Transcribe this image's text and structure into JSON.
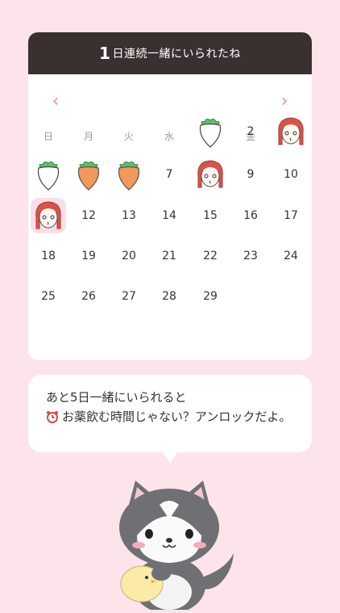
{
  "header": {
    "streak_number": "1",
    "streak_text": "日連続一緒にいられたね"
  },
  "nav": {
    "prev": "‹",
    "next": "›"
  },
  "weekdays": [
    "日",
    "月",
    "火",
    "水",
    "木",
    "金",
    "土"
  ],
  "days": [
    {
      "label": "",
      "icon": "radish-white"
    },
    {
      "label": "2",
      "icon": ""
    },
    {
      "label": "",
      "icon": "girl-face"
    },
    {
      "label": "",
      "icon": "radish-white"
    },
    {
      "label": "",
      "icon": "carrot"
    },
    {
      "label": "",
      "icon": "carrot"
    },
    {
      "label": "7",
      "icon": ""
    },
    {
      "label": "",
      "icon": "girl-face"
    },
    {
      "label": "9",
      "icon": ""
    },
    {
      "label": "10",
      "icon": ""
    },
    {
      "label": "",
      "icon": "girl-face-today"
    },
    {
      "label": "12",
      "icon": ""
    },
    {
      "label": "13",
      "icon": ""
    },
    {
      "label": "14",
      "icon": ""
    },
    {
      "label": "15",
      "icon": ""
    },
    {
      "label": "16",
      "icon": ""
    },
    {
      "label": "17",
      "icon": ""
    },
    {
      "label": "18",
      "icon": ""
    },
    {
      "label": "19",
      "icon": ""
    },
    {
      "label": "20",
      "icon": ""
    },
    {
      "label": "21",
      "icon": ""
    },
    {
      "label": "22",
      "icon": ""
    },
    {
      "label": "23",
      "icon": ""
    },
    {
      "label": "24",
      "icon": ""
    },
    {
      "label": "25",
      "icon": ""
    },
    {
      "label": "26",
      "icon": ""
    },
    {
      "label": "27",
      "icon": ""
    },
    {
      "label": "28",
      "icon": ""
    },
    {
      "label": "29",
      "icon": ""
    }
  ],
  "message": {
    "line1": "あと5日一緒にいられると",
    "line2": "お薬飲む時間じゃない？アンロックだよ。",
    "icon": "alarm-clock-icon"
  },
  "mascot": {
    "icon": "gray-cat-with-chick"
  },
  "colors": {
    "background": "#fde3ea",
    "header": "#3a3030",
    "accent": "#f08aa8",
    "today": "#fcdfe6"
  }
}
